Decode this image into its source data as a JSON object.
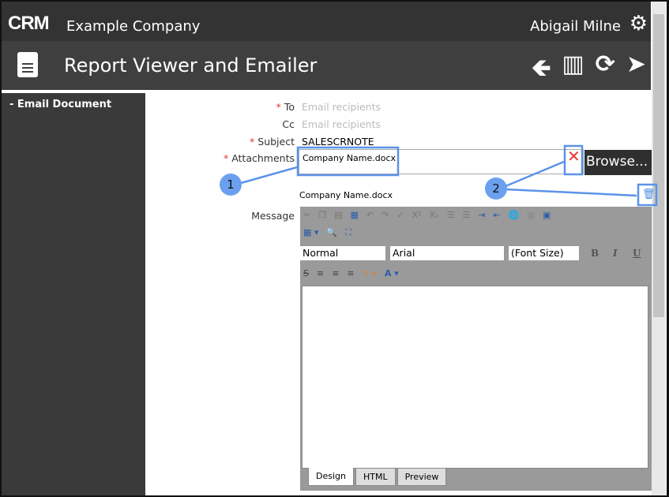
{
  "header": {
    "logo": "CRM",
    "company": "Example Company",
    "user": "Abigail Milne"
  },
  "toolbar": {
    "title": "Report Viewer and Emailer",
    "icons": [
      "back-arrow-icon",
      "building-icon",
      "refresh-icon",
      "send-icon"
    ]
  },
  "sidebar": {
    "items": [
      {
        "label": "Email Document"
      }
    ]
  },
  "form": {
    "to_label": "To",
    "to_placeholder": "Email recipients",
    "cc_label": "Cc",
    "cc_placeholder": "Email recipients",
    "subject_label": "Subject",
    "subject_value": "SALESCRNOTE",
    "attachments_label": "Attachments",
    "attachment_value": "Company Name.docx",
    "browse_label": "Browse...",
    "attached_file": "Company Name.docx",
    "message_label": "Message"
  },
  "editor": {
    "format": "Normal",
    "font": "Arial",
    "size": "(Font Size)",
    "bold": "B",
    "italic": "I",
    "underline": "U",
    "tabs": [
      "Design",
      "HTML",
      "Preview"
    ]
  },
  "annotations": [
    "1",
    "2"
  ]
}
